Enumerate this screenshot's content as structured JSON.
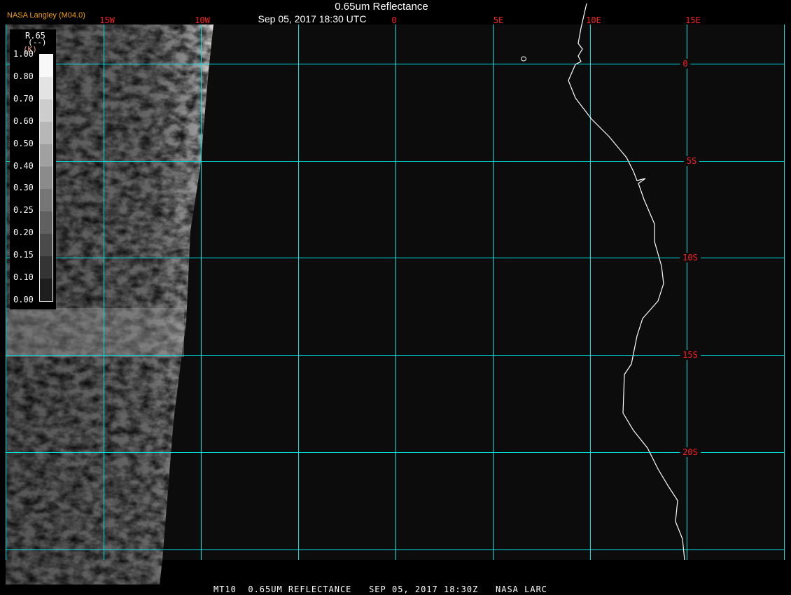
{
  "header": {
    "title": "0.65um Reflectance",
    "subtitle": "Sep 05, 2017 18:30 UTC",
    "credit": "NASA Langley (M04.0)"
  },
  "grid": {
    "longitudes": [
      {
        "label": "15W",
        "lon": -15
      },
      {
        "label": "10W",
        "lon": -10
      },
      {
        "label": "0",
        "lon": 0
      },
      {
        "label": "5E",
        "lon": 5
      },
      {
        "label": "10E",
        "lon": 10
      },
      {
        "label": "15E",
        "lon": 15
      }
    ],
    "latitudes": [
      {
        "label": "0",
        "lat": 0
      },
      {
        "label": "5S",
        "lat": -5
      },
      {
        "label": "10S",
        "lat": -10
      },
      {
        "label": "15S",
        "lat": -15
      },
      {
        "label": "20S",
        "lat": -20
      }
    ],
    "color": "#00e5e5"
  },
  "colorbar": {
    "name": "R.65",
    "units": "(--)",
    "alt_units": "(K)",
    "labels": [
      "1.00",
      "0.80",
      "0.70",
      "0.60",
      "0.50",
      "0.40",
      "0.30",
      "0.25",
      "0.20",
      "0.15",
      "0.10",
      "0.00"
    ]
  },
  "footer": "MT10  0.65UM REFLECTANCE   SEP 05, 2017 18:30Z   NASA LARC"
}
